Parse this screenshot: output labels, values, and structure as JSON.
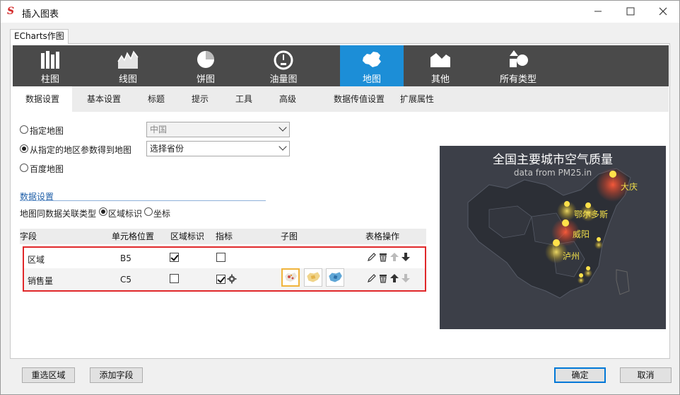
{
  "window": {
    "title": "插入图表",
    "logo": "S",
    "controls": [
      "minimize-icon",
      "maximize-icon",
      "close-icon"
    ]
  },
  "outer_tab": "ECharts作图",
  "chart_types": [
    {
      "label": "柱图",
      "icon": "bar-chart-icon"
    },
    {
      "label": "线图",
      "icon": "line-chart-icon"
    },
    {
      "label": "饼图",
      "icon": "pie-chart-icon"
    },
    {
      "label": "油量图",
      "icon": "gauge-icon"
    },
    {
      "label": "地图",
      "icon": "china-map-icon",
      "active": true
    },
    {
      "label": "其他",
      "icon": "other-chart-icon"
    },
    {
      "label": "所有类型",
      "icon": "all-types-icon"
    }
  ],
  "subtabs": [
    "数据设置",
    "基本设置",
    "标题",
    "提示",
    "工具",
    "高级",
    "数据传值设置",
    "扩展属性"
  ],
  "map_source": {
    "options": [
      {
        "label": "指定地图",
        "checked": false,
        "select_value": "中国",
        "select_disabled": true
      },
      {
        "label": "从指定的地区参数得到地图",
        "checked": true,
        "select_value": "选择省份",
        "select_disabled": false
      },
      {
        "label": "百度地图",
        "checked": false
      }
    ]
  },
  "data_settings": {
    "section_title": "数据设置",
    "assoc_label": "地图同数据关联类型",
    "assoc_options": [
      {
        "label": "区域标识",
        "checked": true
      },
      {
        "label": "坐标",
        "checked": false
      }
    ]
  },
  "table": {
    "headers": [
      "字段",
      "单元格位置",
      "区域标识",
      "指标",
      "子图",
      "表格操作"
    ],
    "rows": [
      {
        "field": "区域",
        "cell": "B5",
        "region_flag": true,
        "indicator": false,
        "has_gear": false,
        "subcharts": [],
        "ops": [
          "edit-icon",
          "delete-icon",
          "move-up-icon",
          "move-down-icon"
        ],
        "up_enabled": false,
        "down_enabled": true
      },
      {
        "field": "销售量",
        "cell": "C5",
        "region_flag": false,
        "indicator": true,
        "has_gear": true,
        "subcharts": [
          "pie-map-thumb",
          "map-thumb",
          "blue-map-thumb"
        ],
        "ops": [
          "edit-icon",
          "delete-icon",
          "move-up-icon",
          "move-down-icon"
        ],
        "up_enabled": true,
        "down_enabled": false
      }
    ]
  },
  "preview": {
    "title": "全国主要城市空气质量",
    "subtitle": "data from PM25.in",
    "cities": [
      "大庆",
      "鄂尔多斯",
      "威阳",
      "泸州"
    ]
  },
  "buttons": {
    "reselect": "重选区域",
    "add_field": "添加字段",
    "ok": "确定",
    "cancel": "取消"
  },
  "colors": {
    "accent": "#1c8ed7",
    "typebar": "#4a4a4a",
    "highlight_box": "#e0282a",
    "preview_bg": "#3c3f48",
    "city_label": "#f3e04a"
  }
}
